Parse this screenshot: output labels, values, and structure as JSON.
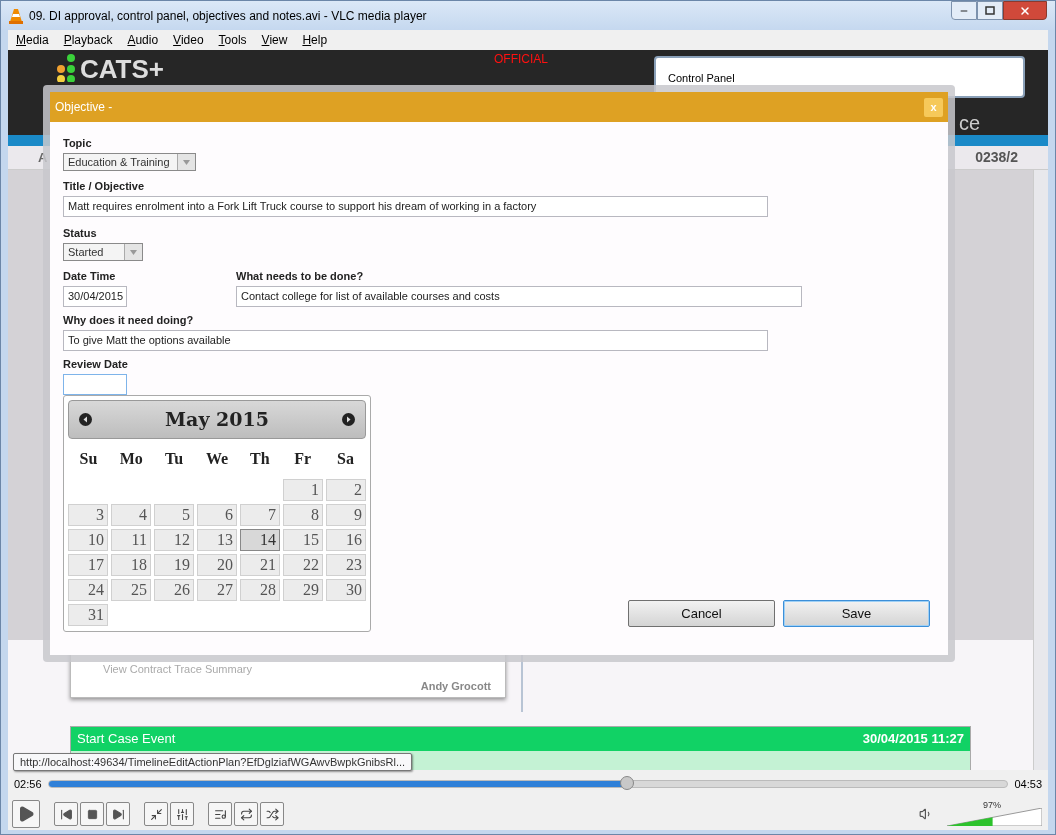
{
  "window": {
    "title": "09. DI approval, control panel, objectives and notes.avi - VLC media player"
  },
  "menu": [
    "Media",
    "Playback",
    "Audio",
    "Video",
    "Tools",
    "View",
    "Help"
  ],
  "page": {
    "logo": "CATS+",
    "banner": "OFFICIAL",
    "control_panel": "Control Panel",
    "header_fragment": "ce",
    "bar_left_fragment": "A",
    "bar_right_fragment": "0238/2",
    "card_link": "View Contract Trace Summary",
    "card_author": "Andy Grocott",
    "event": {
      "title": "Start Case Event",
      "time": "30/04/2015 11:27"
    }
  },
  "dialog": {
    "title": "Objective -",
    "close": "x",
    "topic": {
      "label": "Topic",
      "value": "Education & Training"
    },
    "objective": {
      "label": "Title / Objective",
      "value": "Matt requires enrolment into a Fork Lift Truck course to support his dream of working in a factory"
    },
    "status": {
      "label": "Status",
      "value": "Started"
    },
    "date_time": {
      "label": "Date Time",
      "value": "30/04/2015"
    },
    "what": {
      "label": "What needs to be done?",
      "value": "Contact college for list of available courses and costs"
    },
    "why": {
      "label": "Why does it need doing?",
      "value": "To give Matt the options available"
    },
    "review_date": {
      "label": "Review Date",
      "focused": true
    },
    "calendar": {
      "month": "May 2015",
      "weekdays": [
        "Su",
        "Mo",
        "Tu",
        "We",
        "Th",
        "Fr",
        "Sa"
      ],
      "weeks": [
        [
          {
            "kind": "blank"
          },
          {
            "kind": "blank"
          },
          {
            "kind": "blank"
          },
          {
            "kind": "blank"
          },
          {
            "kind": "blank"
          },
          {
            "day": "1",
            "hovered": false
          },
          {
            "day": "2",
            "hovered": false
          }
        ],
        [
          {
            "day": "3",
            "hovered": false
          },
          {
            "day": "4",
            "hovered": false
          },
          {
            "day": "5",
            "hovered": false
          },
          {
            "day": "6",
            "hovered": false
          },
          {
            "day": "7",
            "hovered": false
          },
          {
            "day": "8",
            "hovered": false
          },
          {
            "day": "9",
            "hovered": false
          }
        ],
        [
          {
            "day": "10",
            "hovered": false
          },
          {
            "day": "11",
            "hovered": false
          },
          {
            "day": "12",
            "hovered": false
          },
          {
            "day": "13",
            "hovered": false
          },
          {
            "day": "14",
            "hovered": true
          },
          {
            "day": "15",
            "hovered": false
          },
          {
            "day": "16",
            "hovered": false
          }
        ],
        [
          {
            "day": "17",
            "hovered": false
          },
          {
            "day": "18",
            "hovered": false
          },
          {
            "day": "19",
            "hovered": false
          },
          {
            "day": "20",
            "hovered": false
          },
          {
            "day": "21",
            "hovered": false
          },
          {
            "day": "22",
            "hovered": false
          },
          {
            "day": "23",
            "hovered": false
          }
        ],
        [
          {
            "day": "24",
            "hovered": false
          },
          {
            "day": "25",
            "hovered": false
          },
          {
            "day": "26",
            "hovered": false
          },
          {
            "day": "27",
            "hovered": false
          },
          {
            "day": "28",
            "hovered": false
          },
          {
            "day": "29",
            "hovered": false
          },
          {
            "day": "30",
            "hovered": false
          }
        ],
        [
          {
            "day": "31",
            "hovered": false
          }
        ]
      ]
    },
    "buttons": [
      {
        "label": "Cancel",
        "focused": false
      },
      {
        "label": "Save",
        "focused": true
      }
    ]
  },
  "tooltip": "http://localhost:49634/TimelineEditActionPlan?EfDglziafWGAwvBwpkGnibsRl...",
  "player": {
    "elapsed": "02:56",
    "total": "04:53",
    "position": {
      "level": 0.603
    },
    "volume": {
      "label": "97%",
      "level": 0.48
    }
  }
}
